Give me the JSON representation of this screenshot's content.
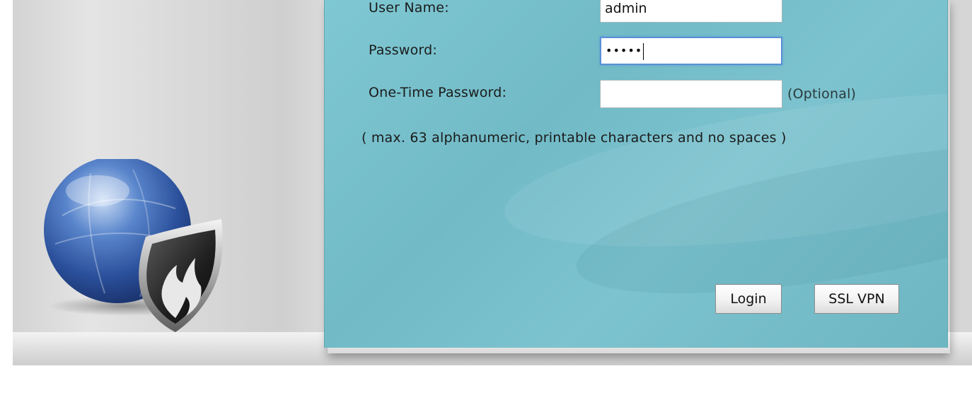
{
  "login_form": {
    "username_label": "User Name:",
    "username_value": "admin",
    "password_label": "Password:",
    "password_masked": "•••••",
    "otp_label": "One-Time Password:",
    "otp_value": "",
    "otp_hint": "(Optional)",
    "password_note": "( max. 63 alphanumeric, printable characters and no spaces )",
    "login_button": "Login",
    "sslvpn_button": "SSL VPN"
  },
  "branding": {
    "logo_icon": "globe-shield-flame-icon"
  },
  "colors": {
    "panel": "#7cc3cf",
    "background": "#d6d6d6",
    "focus_border": "#5b8fd8"
  }
}
